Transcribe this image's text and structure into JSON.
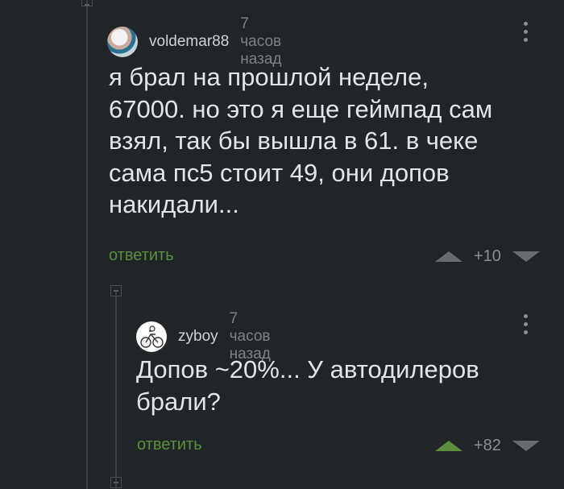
{
  "comments": [
    {
      "username": "voldemar88",
      "time": "7 часов назад",
      "text": "я брал на прошлой неделе, 67000. но это я еще геймпад сам взял, так бы вышла в 61. в чеке сама пс5 стоит 49, они допов накидали...",
      "reply_label": "ответить",
      "score": "+10",
      "upvoted": false
    },
    {
      "username": "zyboy",
      "time": "7 часов назад",
      "text": "Допов ~20%... У автодилеров брали?",
      "reply_label": "ответить",
      "score": "+82",
      "upvoted": true
    }
  ],
  "colors": {
    "background": "#222527",
    "accent_green": "#5b8f3e",
    "text": "#e2e4e5",
    "muted": "#7c8184"
  },
  "icons": [
    "collapse-icon",
    "avatar",
    "more-icon",
    "upvote-icon",
    "downvote-icon"
  ]
}
